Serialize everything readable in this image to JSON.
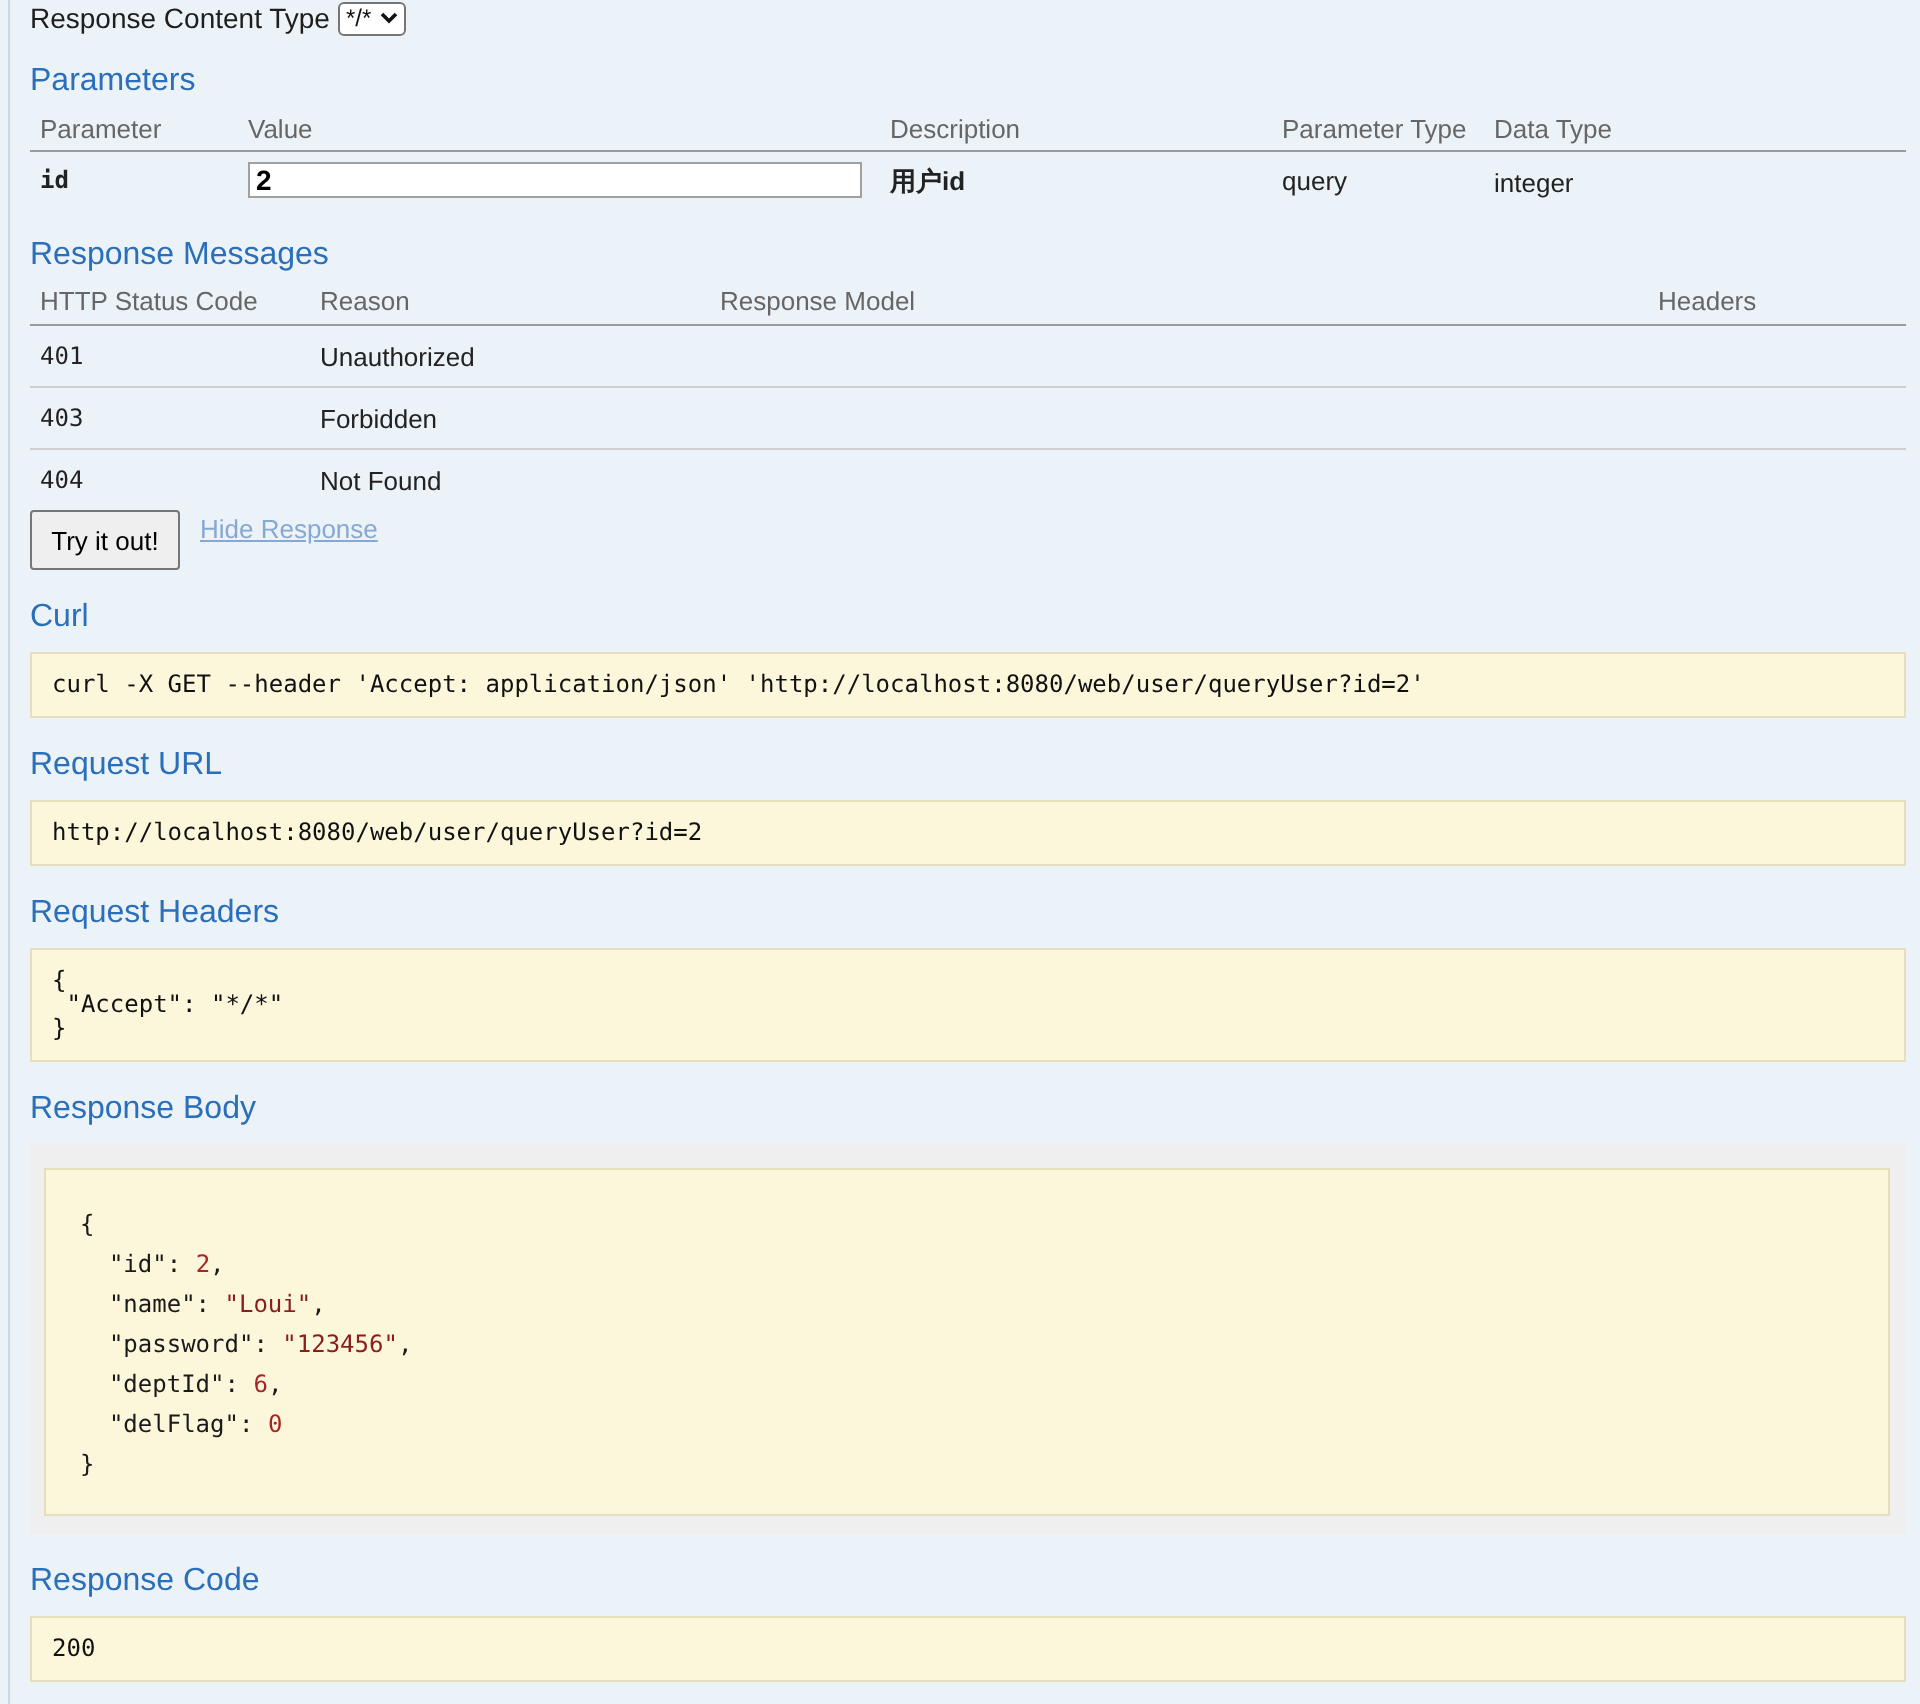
{
  "content_type": {
    "label": "Response Content Type",
    "value": "*/*"
  },
  "parameters": {
    "title": "Parameters",
    "columns": [
      "Parameter",
      "Value",
      "Description",
      "Parameter Type",
      "Data Type"
    ],
    "rows": [
      {
        "parameter": "id",
        "value": "2",
        "description": "用户id",
        "parameter_type": "query",
        "data_type": "integer"
      }
    ]
  },
  "response_messages": {
    "title": "Response Messages",
    "columns": [
      "HTTP Status Code",
      "Reason",
      "Response Model",
      "Headers"
    ],
    "rows": [
      {
        "code": "401",
        "reason": "Unauthorized"
      },
      {
        "code": "403",
        "reason": "Forbidden"
      },
      {
        "code": "404",
        "reason": "Not Found"
      }
    ]
  },
  "actions": {
    "try_button": "Try it out!",
    "hide_link": "Hide Response"
  },
  "sections": [
    {
      "kind": "code",
      "title": "Curl",
      "lines": [
        "curl -X GET --header 'Accept: application/json' 'http://localhost:8080/web/user/queryUser?id=2'"
      ]
    },
    {
      "kind": "code",
      "title": "Request URL",
      "lines": [
        "http://localhost:8080/web/user/queryUser?id=2"
      ]
    },
    {
      "kind": "code",
      "title": "Request Headers",
      "lines": [
        "{",
        " \"Accept\": \"*/*\"",
        "}"
      ]
    },
    {
      "kind": "json",
      "title": "Response Body",
      "lines": [
        [
          {
            "text": "{",
            "kind": "punct"
          }
        ],
        [
          {
            "text": "  \"id\"",
            "kind": "key"
          },
          {
            "text": ": ",
            "kind": "punct"
          },
          {
            "text": "2",
            "kind": "number"
          },
          {
            "text": ",",
            "kind": "punct"
          }
        ],
        [
          {
            "text": "  \"name\"",
            "kind": "key"
          },
          {
            "text": ": ",
            "kind": "punct"
          },
          {
            "text": "\"Loui\"",
            "kind": "string"
          },
          {
            "text": ",",
            "kind": "punct"
          }
        ],
        [
          {
            "text": "  \"password\"",
            "kind": "key"
          },
          {
            "text": ": ",
            "kind": "punct"
          },
          {
            "text": "\"123456\"",
            "kind": "string"
          },
          {
            "text": ",",
            "kind": "punct"
          }
        ],
        [
          {
            "text": "  \"deptId\"",
            "kind": "key"
          },
          {
            "text": ": ",
            "kind": "punct"
          },
          {
            "text": "6",
            "kind": "number"
          },
          {
            "text": ",",
            "kind": "punct"
          }
        ],
        [
          {
            "text": "  \"delFlag\"",
            "kind": "key"
          },
          {
            "text": ": ",
            "kind": "punct"
          },
          {
            "text": "0",
            "kind": "number"
          }
        ],
        [
          {
            "text": "}",
            "kind": "punct"
          }
        ]
      ]
    },
    {
      "kind": "code",
      "title": "Response Code",
      "lines": [
        "200"
      ]
    }
  ]
}
